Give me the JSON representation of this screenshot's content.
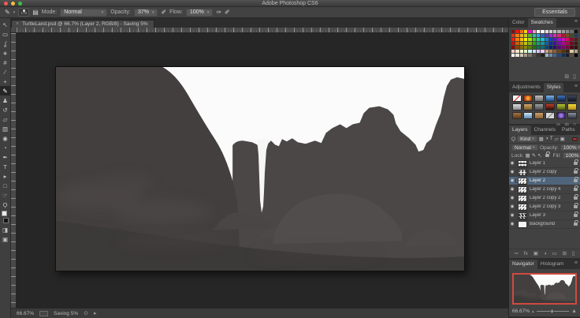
{
  "window": {
    "title": "Adobe Photoshop CS6"
  },
  "options_bar": {
    "tool_icon": "✎",
    "brush_preset_size": "178",
    "panel_toggle_icon": "▤",
    "mode_label": "Mode:",
    "mode_value": "Normal",
    "opacity_label": "Opacity:",
    "opacity_value": "37%",
    "flow_label": "Flow:",
    "flow_value": "100%",
    "pressure_opacity_icon": "✐",
    "airbrush_icon": "✑",
    "pressure_size_icon": "✐",
    "workspace_button": "Essentials"
  },
  "document_tab": {
    "close_glyph": "×",
    "title": "TurtleLand.psd @ 66.7% (Layer 2, RGB/8) - Saving 5%"
  },
  "toolbar": {
    "tools": [
      {
        "name": "move",
        "glyph": "↖"
      },
      {
        "name": "rectangular-marquee",
        "glyph": "▭"
      },
      {
        "name": "lasso",
        "glyph": "ʆ"
      },
      {
        "name": "quick-selection",
        "glyph": "∗"
      },
      {
        "name": "crop",
        "glyph": "#"
      },
      {
        "name": "eyedropper",
        "glyph": "∕"
      },
      {
        "name": "healing-brush",
        "glyph": "+"
      },
      {
        "name": "brush",
        "glyph": "✎",
        "selected": true
      },
      {
        "name": "clone-stamp",
        "glyph": "♟"
      },
      {
        "name": "history-brush",
        "glyph": "↺"
      },
      {
        "name": "eraser",
        "glyph": "▱"
      },
      {
        "name": "gradient",
        "glyph": "▥"
      },
      {
        "name": "blur",
        "glyph": "◉"
      },
      {
        "name": "dodge",
        "glyph": "◔"
      },
      {
        "name": "pen",
        "glyph": "✒"
      },
      {
        "name": "type",
        "glyph": "T"
      },
      {
        "name": "path-selection",
        "glyph": "▸"
      },
      {
        "name": "shape",
        "glyph": "□"
      },
      {
        "name": "hand",
        "glyph": "☞"
      },
      {
        "name": "zoom",
        "glyph": "Ϙ"
      },
      {
        "name": "foreground-background-colors",
        "type": "colorchip"
      },
      {
        "name": "quick-mask",
        "glyph": "◨"
      },
      {
        "name": "screen-mode",
        "glyph": "▣"
      }
    ]
  },
  "panels": {
    "color_swatches": {
      "tabs": [
        "Color",
        "Swatches"
      ],
      "active_tab": "Swatches",
      "panel_menu_icon": "≡",
      "footer_icons": [
        {
          "name": "new-swatch-icon",
          "glyph": "⊞"
        },
        {
          "name": "delete-swatch-icon",
          "glyph": "▯"
        }
      ],
      "swatch_rows": [
        [
          "#7f1010",
          "#e01b0d",
          "#f07013",
          "#f5d415",
          "#e014c9",
          "#ef8fd0",
          "#ffffff",
          "#f0f0f0",
          "#e0e0e0",
          "#d0d0d0",
          "#c0c0c0",
          "#afafaf",
          "#9d9d9d",
          "#8a8a8a",
          "#6e6e6e",
          "#111111"
        ],
        [
          "#e2340f",
          "#ef7c16",
          "#f2b01c",
          "#c7cc1f",
          "#58b52a",
          "#2bbf9a",
          "#28a7df",
          "#2b62c4",
          "#5b3bbf",
          "#9b30c8",
          "#d42ab4",
          "#e0266b",
          "#a81c37",
          "#7c4a21",
          "#4a4a21",
          "#233a63"
        ],
        [
          "#ff1a0a",
          "#ff7a00",
          "#ffc400",
          "#fff200",
          "#a8e10e",
          "#35d60e",
          "#0ed68f",
          "#0ec4d6",
          "#0e7fd6",
          "#0e3cd6",
          "#5a0ed6",
          "#a00ed6",
          "#d60eb4",
          "#d60e62",
          "#8c0e2e",
          "#5a1c0e"
        ],
        [
          "#c41208",
          "#c46108",
          "#c49a08",
          "#c4c408",
          "#85b20b",
          "#2aa80b",
          "#0ba86f",
          "#0b9aa8",
          "#0b64a8",
          "#0b2fa8",
          "#470ba8",
          "#7e0ba8",
          "#a80b8d",
          "#a80b4d",
          "#6e0b24",
          "#47160b"
        ],
        [
          "#8a0d06",
          "#8a4506",
          "#8a6d06",
          "#8a8a06",
          "#5e7d08",
          "#1e7608",
          "#08764e",
          "#086d76",
          "#084676",
          "#082176",
          "#320876",
          "#590876",
          "#760863",
          "#760836",
          "#4d081a",
          "#321008"
        ],
        [
          "#f7c8c8",
          "#f7e3c8",
          "#f7f5c8",
          "#def7c8",
          "#c8f7ec",
          "#c8ddf7",
          "#d2c8f7",
          "#f0c8f7",
          "#caa57e",
          "#b08050",
          "#8f6234",
          "#6f4722",
          "#52331a",
          "#3a2413",
          "#d9c9a3",
          "#b5a079"
        ],
        [
          "#ffffff",
          "#e8e4da",
          "#cfc7b8",
          "#a89e8c",
          "#7d746a",
          "#564f48",
          "#3a3631",
          "#23211e",
          "#9fb4c8",
          "#6f8aa8",
          "#47648a",
          "#2c456b",
          "#1a2c4d",
          "#101c33",
          "#5d4a36",
          "#000000"
        ]
      ]
    },
    "adjustments_styles": {
      "tabs": [
        "Adjustments",
        "Styles"
      ],
      "active_tab": "Styles",
      "panel_menu_icon": "≡",
      "footer_icons": [
        {
          "name": "clear-style-icon",
          "glyph": "⊘"
        },
        {
          "name": "new-style-icon",
          "glyph": "⊞"
        },
        {
          "name": "delete-style-icon",
          "glyph": "▯"
        }
      ],
      "styles": [
        {
          "name": "none",
          "bg": "linear-gradient(135deg,#f5f5f5 45%,#d33 48%,#d33 55%,#f5f5f5 58%)"
        },
        {
          "name": "orange-glow",
          "bg": "radial-gradient(circle,#f5a62d 20%,#a32c10 80%)"
        },
        {
          "name": "gray-bevel",
          "bg": "linear-gradient(#bcbcbc,#6f6f6f)"
        },
        {
          "name": "blue-gloss",
          "bg": "linear-gradient(#7db6e8,#1d4f8c)"
        },
        {
          "name": "blue-gradient",
          "bg": "linear-gradient(#3a76c4,#10213c)"
        },
        {
          "name": "dark-navy",
          "bg": "linear-gradient(#3c465c,#14161f)"
        },
        {
          "name": "silver",
          "bg": "linear-gradient(#dcdcdc,#8e8e8e)"
        },
        {
          "name": "tan",
          "bg": "linear-gradient(#cfa76a,#7c5a2c)"
        },
        {
          "name": "gray-pill",
          "bg": "linear-gradient(#9f9f9f,#4d4d4d)"
        },
        {
          "name": "red-black",
          "bg": "linear-gradient(#c23b2a,#2a0d0a)"
        },
        {
          "name": "green-gold",
          "bg": "linear-gradient(#b9c435,#4e5a12)"
        },
        {
          "name": "yellow-frame",
          "bg": "linear-gradient(#f1d93c,#b78f14)"
        },
        {
          "name": "wood",
          "bg": "linear-gradient(#a5713d,#5d3a1a)"
        },
        {
          "name": "sky",
          "bg": "linear-gradient(#cfe4f2,#5d89ad)"
        },
        {
          "name": "leather",
          "bg": "linear-gradient(#c9a06a,#8a6336)"
        },
        {
          "name": "gray-cross",
          "bg": "linear-gradient(135deg,#d8d8d8 45%,#888 48%,#888 55%,#d8d8d8 58%)"
        },
        {
          "name": "purple-glow",
          "bg": "radial-gradient(circle,#9a7ae0 25%,#3a1d6e 80%)"
        },
        {
          "name": "steel",
          "bg": "linear-gradient(#8a94a0,#2e343c)"
        }
      ]
    },
    "layers": {
      "tabs": [
        "Layers",
        "Channels",
        "Paths"
      ],
      "active_tab": "Layers",
      "panel_menu_icon": "≡",
      "filter_icon": "Ϙ",
      "filter_value": "Kind",
      "filter_type_icons": [
        {
          "name": "filter-pixel-icon",
          "glyph": "▦"
        },
        {
          "name": "filter-adjustment-icon",
          "glyph": "◑"
        },
        {
          "name": "filter-type-icon",
          "glyph": "T"
        },
        {
          "name": "filter-shape-icon",
          "glyph": "▱"
        },
        {
          "name": "filter-smart-object-icon",
          "glyph": "▣"
        }
      ],
      "blend_mode": "Normal",
      "opacity_label": "Opacity:",
      "opacity_value": "100%",
      "lock_label": "Lock:",
      "lock_icons": [
        {
          "name": "lock-transparency-icon",
          "glyph": "▦"
        },
        {
          "name": "lock-paint-icon",
          "glyph": "✎"
        },
        {
          "name": "lock-move-icon",
          "glyph": "↖"
        }
      ],
      "fill_label": "Fill:",
      "fill_value": "100%",
      "eye_glyph": "◉",
      "rows": [
        {
          "name": "Layer 1",
          "thumb": "t-streak",
          "selected": false
        },
        {
          "name": "Layer 2 copy",
          "thumb": "t-blob",
          "selected": false
        },
        {
          "name": "Layer 2",
          "thumb": "t-marks",
          "selected": true
        },
        {
          "name": "Layer 2 copy 4",
          "thumb": "t-marks",
          "selected": false
        },
        {
          "name": "Layer 2 copy 2",
          "thumb": "t-marks",
          "selected": false
        },
        {
          "name": "Layer 2 copy 3",
          "thumb": "t-marks",
          "selected": false
        },
        {
          "name": "Layer 3",
          "thumb": "t-bumps",
          "selected": false
        },
        {
          "name": "Background",
          "thumb": "t-white",
          "selected": false
        }
      ],
      "bottom_icons": [
        {
          "name": "link-layers-icon",
          "glyph": "∾"
        },
        {
          "name": "layer-style-icon",
          "glyph": "fx"
        },
        {
          "name": "add-mask-icon",
          "glyph": "▣"
        },
        {
          "name": "adjustment-layer-icon",
          "glyph": "◑"
        },
        {
          "name": "new-group-icon",
          "glyph": "▭"
        },
        {
          "name": "new-layer-icon",
          "glyph": "⊞"
        },
        {
          "name": "delete-layer-icon",
          "glyph": "▯"
        }
      ]
    },
    "navigator": {
      "tabs": [
        "Navigator",
        "Histogram"
      ],
      "active_tab": "Navigator",
      "panel_menu_icon": "≡",
      "zoom_value": "66.67%",
      "zoom_out_icon": "▴",
      "zoom_in_icon": "▲"
    }
  },
  "status_bar": {
    "zoom_value": "66.67%",
    "message": "Saving 5%",
    "icon_a": "⊙",
    "icon_b": "▸"
  },
  "colors": {
    "selection_blue": "#50657c",
    "navigator_proxy_border": "#cf4a40",
    "sky": "#fbfbfb",
    "dome_rock": "#433f3e",
    "right_rock": "#4b4747",
    "boulder": "#514d4c",
    "foreground": "#3c3939"
  }
}
